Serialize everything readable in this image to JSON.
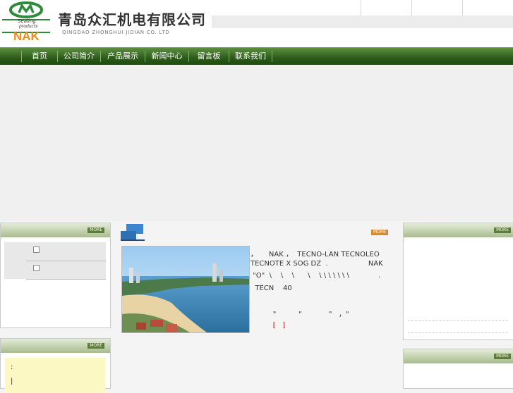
{
  "header": {
    "logo_small_text_1": "Sealing",
    "logo_small_text_2": "products",
    "logo_brand": "NAK",
    "company_cn": "青岛众汇机电有限公司",
    "company_en": "QINGDAO ZHONGHUI JIDIAN CO. LTD"
  },
  "nav": {
    "items": [
      "首页",
      "公司简介",
      "产品展示",
      "新闻中心",
      "留言板",
      "联系我们"
    ]
  },
  "left_panel_top": {
    "more": "MORE"
  },
  "left_panel_bottom": {
    "more": "MORE",
    "line1": ":",
    "line2": "|"
  },
  "center": {
    "more": "MORE",
    "lines": [
      "，     NAK ，  TECNO-LAN TECNOLEO",
      "TECNOTE X SOG DZ  .                  NAK",
      " \"O\"  \\    \\    \\      \\    \\ \\ \\ \\ \\ \\ \\             .",
      "  TECN    40",
      "",
      "          \"          \"            \"   ，\"",
      "          [   ]"
    ]
  },
  "right_panel_top": {
    "more": "MORE"
  },
  "right_panel_bottom": {
    "more": "MORE"
  },
  "colors": {
    "nav_green": "#2c5b1a",
    "logo_green": "#2e8b3a",
    "logo_orange": "#f08a1c",
    "more_orange": "#d98a2a"
  }
}
